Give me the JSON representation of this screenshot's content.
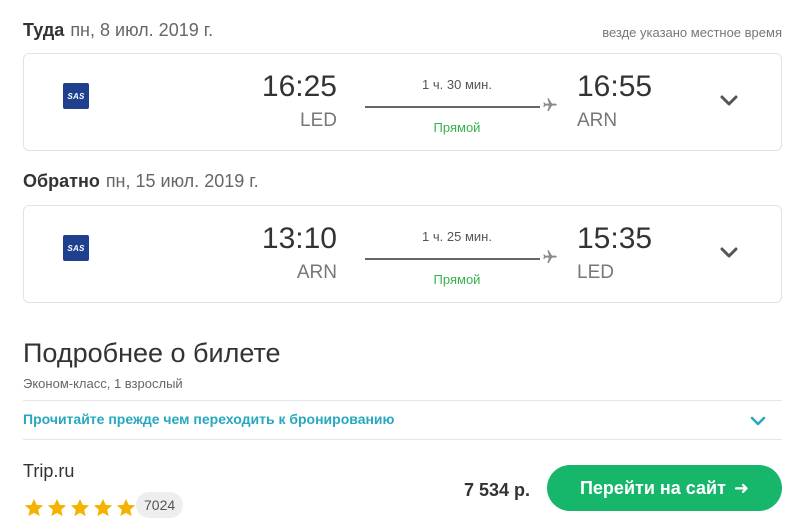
{
  "outbound": {
    "direction_label": "Туда",
    "date": "пн, 8 июл. 2019 г.",
    "timezone_note": "везде указано местное время",
    "airline_logo_text": "SAS",
    "depart_time": "16:25",
    "depart_code": "LED",
    "duration": "1 ч. 30 мин.",
    "flight_type": "Прямой",
    "arrive_time": "16:55",
    "arrive_code": "ARN"
  },
  "return": {
    "direction_label": "Обратно",
    "date": "пн, 15 июл. 2019 г.",
    "airline_logo_text": "SAS",
    "depart_time": "13:10",
    "depart_code": "ARN",
    "duration": "1 ч. 25 мин.",
    "flight_type": "Прямой",
    "arrive_time": "15:35",
    "arrive_code": "LED"
  },
  "ticket_details": {
    "title": "Подробнее о билете",
    "class_info": "Эконом-класс, 1 взрослый",
    "read_before_link": "Прочитайте прежде чем переходить к бронированию"
  },
  "offer": {
    "vendor": "Trip.ru",
    "rating_stars": 5,
    "review_count": "7024",
    "price": "7 534 р.",
    "button_label": "Перейти на сайт"
  },
  "colors": {
    "accent_green": "#17b76b",
    "link_teal": "#27a8bf",
    "direct_green": "#37b24d",
    "airline_blue": "#1f3f8f",
    "star_gold": "#f5b301"
  },
  "icons": {
    "airline": "sas-logo",
    "plane": "plane-icon",
    "expand": "chevron-down-icon",
    "go": "arrow-right-icon",
    "star": "star-icon"
  }
}
